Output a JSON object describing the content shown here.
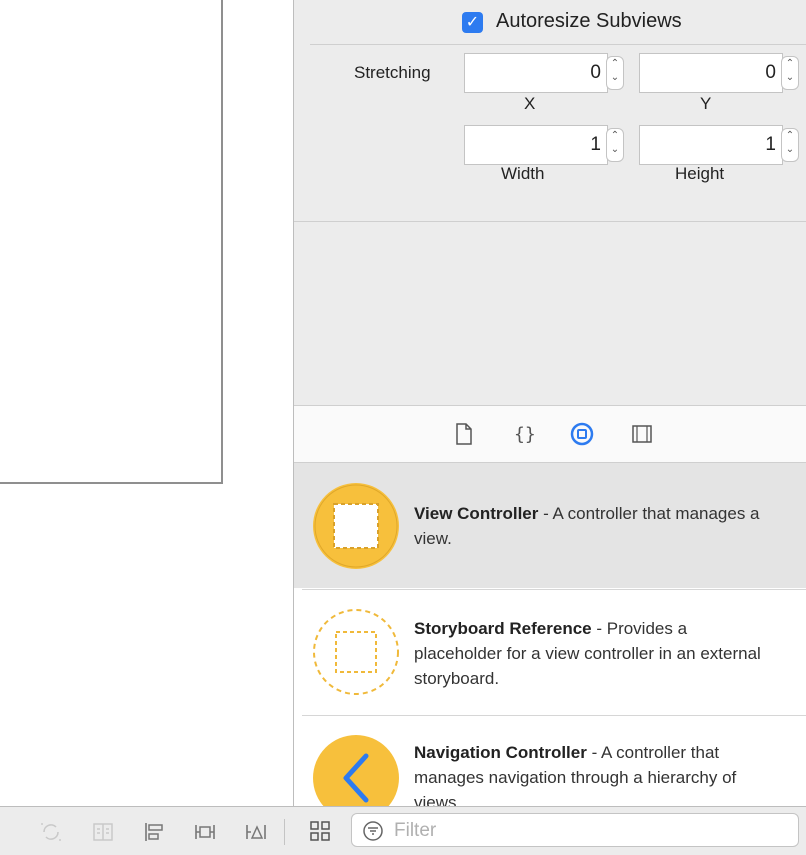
{
  "inspector": {
    "autoresize_label": "Autoresize Subviews",
    "stretching_label": "Stretching",
    "stretch_x": {
      "value": "0",
      "label": "X"
    },
    "stretch_y": {
      "value": "0",
      "label": "Y"
    },
    "stretch_w": {
      "value": "1",
      "label": "Width"
    },
    "stretch_h": {
      "value": "1",
      "label": "Height"
    }
  },
  "library": {
    "tabs": [
      "file-template-icon",
      "code-snippet-icon",
      "object-library-icon",
      "media-library-icon"
    ],
    "active_tab": "object-library-icon",
    "items": [
      {
        "title": "View Controller",
        "desc": " - A controller that manages a view.",
        "selected": true
      },
      {
        "title": "Storyboard Reference",
        "desc": " - Provides a placeholder for a view controller in an external storyboard.",
        "selected": false
      },
      {
        "title": "Navigation Controller",
        "desc": " - A controller that manages navigation through a hierarchy of views.",
        "selected": false
      }
    ]
  },
  "bottom": {
    "filter_placeholder": "Filter"
  },
  "colors": {
    "accent": "#2d7bf0",
    "thumb_yellow": "#f7c03c",
    "selected_row": "#e4e4e4"
  }
}
